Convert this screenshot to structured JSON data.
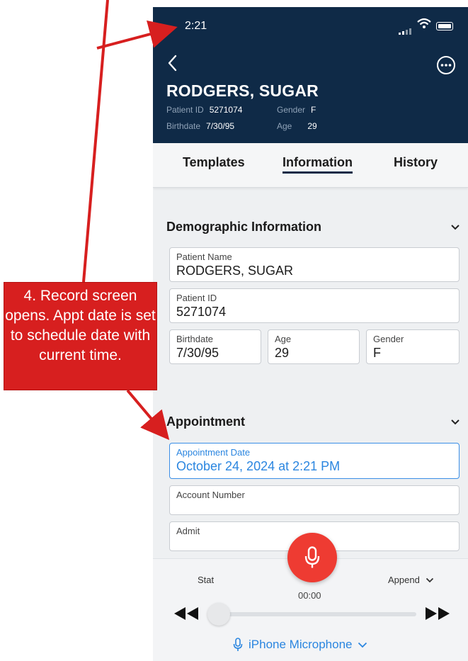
{
  "status_bar": {
    "time": "2:21"
  },
  "header": {
    "patient_name": "RODGERS, SUGAR",
    "patient_id_label": "Patient ID",
    "patient_id": "5271074",
    "gender_label": "Gender",
    "gender": "F",
    "birthdate_label": "Birthdate",
    "birthdate": "7/30/95",
    "age_label": "Age",
    "age": "29"
  },
  "tabs": [
    {
      "label": "Templates",
      "active": false
    },
    {
      "label": "Information",
      "active": true
    },
    {
      "label": "History",
      "active": false
    }
  ],
  "demographic": {
    "title": "Demographic Information",
    "patient_name": {
      "label": "Patient Name",
      "value": "RODGERS, SUGAR"
    },
    "patient_id": {
      "label": "Patient ID",
      "value": "5271074"
    },
    "birthdate": {
      "label": "Birthdate",
      "value": "7/30/95"
    },
    "age": {
      "label": "Age",
      "value": "29"
    },
    "gender": {
      "label": "Gender",
      "value": "F"
    }
  },
  "appointment": {
    "title": "Appointment",
    "date": {
      "label": "Appointment Date",
      "value": "October 24, 2024 at 2:21 PM"
    },
    "account": {
      "label": "Account Number",
      "value": ""
    },
    "admit": {
      "label": "Admit",
      "value": ""
    }
  },
  "recorder": {
    "stat_label": "Stat",
    "append_label": "Append",
    "timer": "00:00",
    "progress": 0,
    "input_source": "iPhone Microphone"
  },
  "annotation": {
    "text": "4. Record screen opens. Appt date is set to schedule date with current time."
  },
  "colors": {
    "header_bg": "#0f2a47",
    "accent": "#2b86e0",
    "record": "#ee3b32",
    "callout": "#d71f1f"
  }
}
